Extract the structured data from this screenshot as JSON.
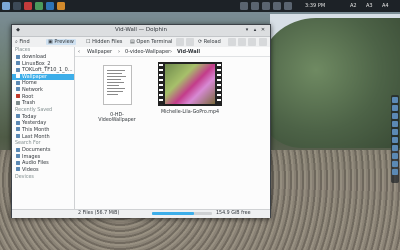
{
  "panel": {
    "clock": "3:39 PM",
    "tray": [
      "A2",
      "A3",
      "A4"
    ]
  },
  "window": {
    "title": "Vid-Wall — Dolphin",
    "toolbar": {
      "find": "Find",
      "preview": "Preview",
      "hidden_files": "Hidden Files",
      "open_terminal": "Open Terminal",
      "reload": "Reload"
    },
    "sidebar": {
      "places_header": "Places",
      "places": [
        "download",
        "LinuxBox_2",
        "TOKLoft_TF10_1_0...",
        "Wallpaper",
        "Home",
        "Network",
        "Root",
        "Trash"
      ],
      "recent_header": "Recently Saved",
      "recent": [
        "Today",
        "Yesterday",
        "This Month",
        "Last Month"
      ],
      "search_header": "Search For",
      "search": [
        "Documents",
        "Images",
        "Audio Files",
        "Videos"
      ],
      "devices_header": "Devices",
      "selected_index": 3
    },
    "breadcrumb": [
      "Wallpaper",
      "0-video-Wallpaper",
      "Vid-Wall"
    ],
    "files": [
      {
        "name": "0-HD-VideoWallpaper",
        "kind": "document"
      },
      {
        "name": "Michelle-Lila-GoPro.mp4",
        "kind": "video"
      }
    ],
    "status": {
      "summary": "2 Files (56.7 MiB)",
      "free": "154.9 GiB free",
      "usage_fraction": 0.7
    }
  }
}
